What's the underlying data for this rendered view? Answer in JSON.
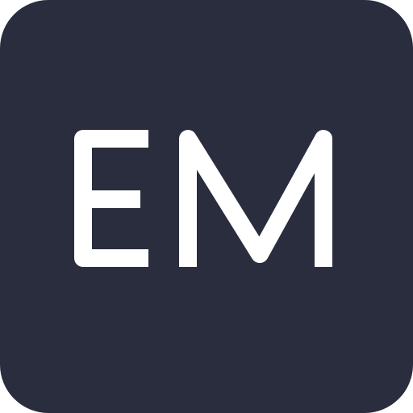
{
  "app_icon": {
    "initials": "EM",
    "background_color": "#292d3d",
    "text_color": "#ffffff"
  }
}
